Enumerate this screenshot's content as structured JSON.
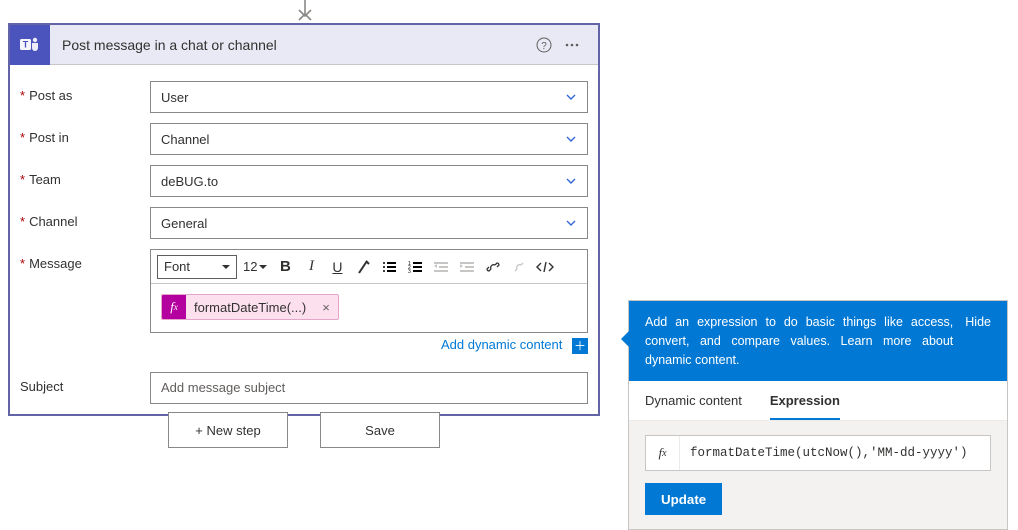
{
  "card": {
    "title": "Post message in a chat or channel",
    "fields": {
      "post_as": {
        "label": "Post as",
        "value": "User"
      },
      "post_in": {
        "label": "Post in",
        "value": "Channel"
      },
      "team": {
        "label": "Team",
        "value": "deBUG.to"
      },
      "channel": {
        "label": "Channel",
        "value": "General"
      },
      "message": {
        "label": "Message"
      },
      "subject": {
        "label": "Subject",
        "placeholder": "Add message subject"
      }
    },
    "toolbar": {
      "font": "Font",
      "size": "12"
    },
    "chip": {
      "label": "formatDateTime(...)"
    },
    "dynamic_link": "Add dynamic content"
  },
  "buttons": {
    "new_step": "+ New step",
    "save": "Save"
  },
  "panel": {
    "hint": "Add an expression to do basic things like access, convert, and compare values. ",
    "learn": "Learn more about dynamic content.",
    "hide": "Hide",
    "tabs": {
      "dynamic": "Dynamic content",
      "expression": "Expression"
    },
    "expression": "formatDateTime(utcNow(),'MM-dd-yyyy')",
    "update": "Update"
  }
}
